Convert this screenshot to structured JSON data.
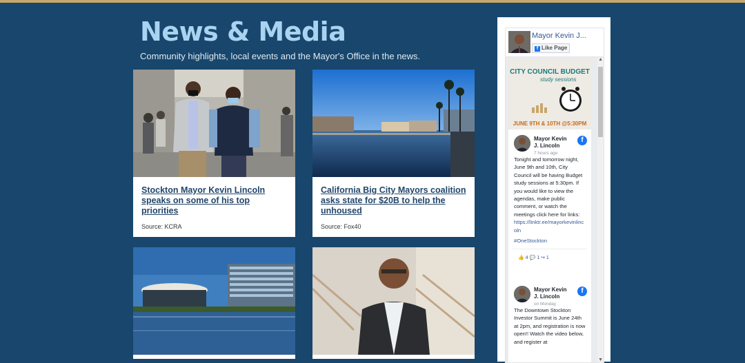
{
  "page": {
    "title": "News & Media",
    "subtitle": "Community highlights, local events and the Mayor's Office in the news."
  },
  "articles": [
    {
      "headline": "Stockton Mayor Kevin Lincoln speaks on some of his top priorities",
      "source": "Source: KCRA"
    },
    {
      "headline": "California Big City Mayors coalition asks state for $20B to help the unhoused",
      "source": "Source: Fox40"
    }
  ],
  "facebook": {
    "page_name": "Mayor Kevin J...",
    "like_label": "Like Page",
    "budget_image": {
      "line1": "CITY COUNCIL BUDGET",
      "line2": "study sessions",
      "line3": "JUNE 9TH & 10TH @5:30PM"
    },
    "posts": [
      {
        "author_line1": "Mayor Kevin",
        "author_line2": "J. Lincoln",
        "time": "7 hours ago",
        "text": "Tonight and tomorrow night, June 9th and 10th, City Council will be having Budget study sessions at 5:30pm. If you would like to view the agendas, make public comment, or watch the meetings click here for links:",
        "link": "https://linktr.ee/mayorkevinlincoln",
        "hashtag": "#OneStockton",
        "reactions": "4",
        "comments": "1",
        "shares": "1"
      },
      {
        "author_line1": "Mayor Kevin",
        "author_line2": "J. Lincoln",
        "time": "on Monday",
        "text": "The Downtown Stockton Investor Summit is June 24th at 2pm, and registration is now open!! Watch the video below, and register at"
      }
    ]
  },
  "colors": {
    "background": "#18466c",
    "title": "#a9d3f0",
    "headline": "#22466a",
    "facebook": "#1877f2"
  }
}
